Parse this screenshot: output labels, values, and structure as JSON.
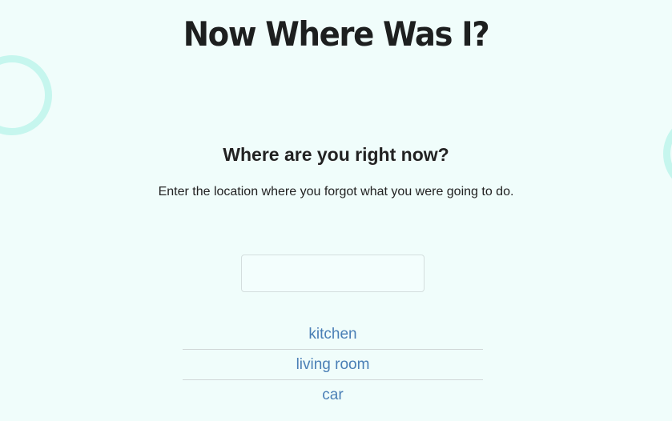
{
  "app": {
    "title": "Now Where Was I?"
  },
  "prompt": {
    "question": "Where are you right now?",
    "instructions": "Enter the location where you forgot what you were going to do."
  },
  "location_input": {
    "value": "",
    "placeholder": ""
  },
  "locations": [
    {
      "label": "kitchen"
    },
    {
      "label": "living room"
    },
    {
      "label": "car"
    }
  ],
  "colors": {
    "background": "#f0fdfb",
    "decor_circle": "#c6f6ee",
    "link": "#4a7fb6",
    "text": "#222222"
  }
}
